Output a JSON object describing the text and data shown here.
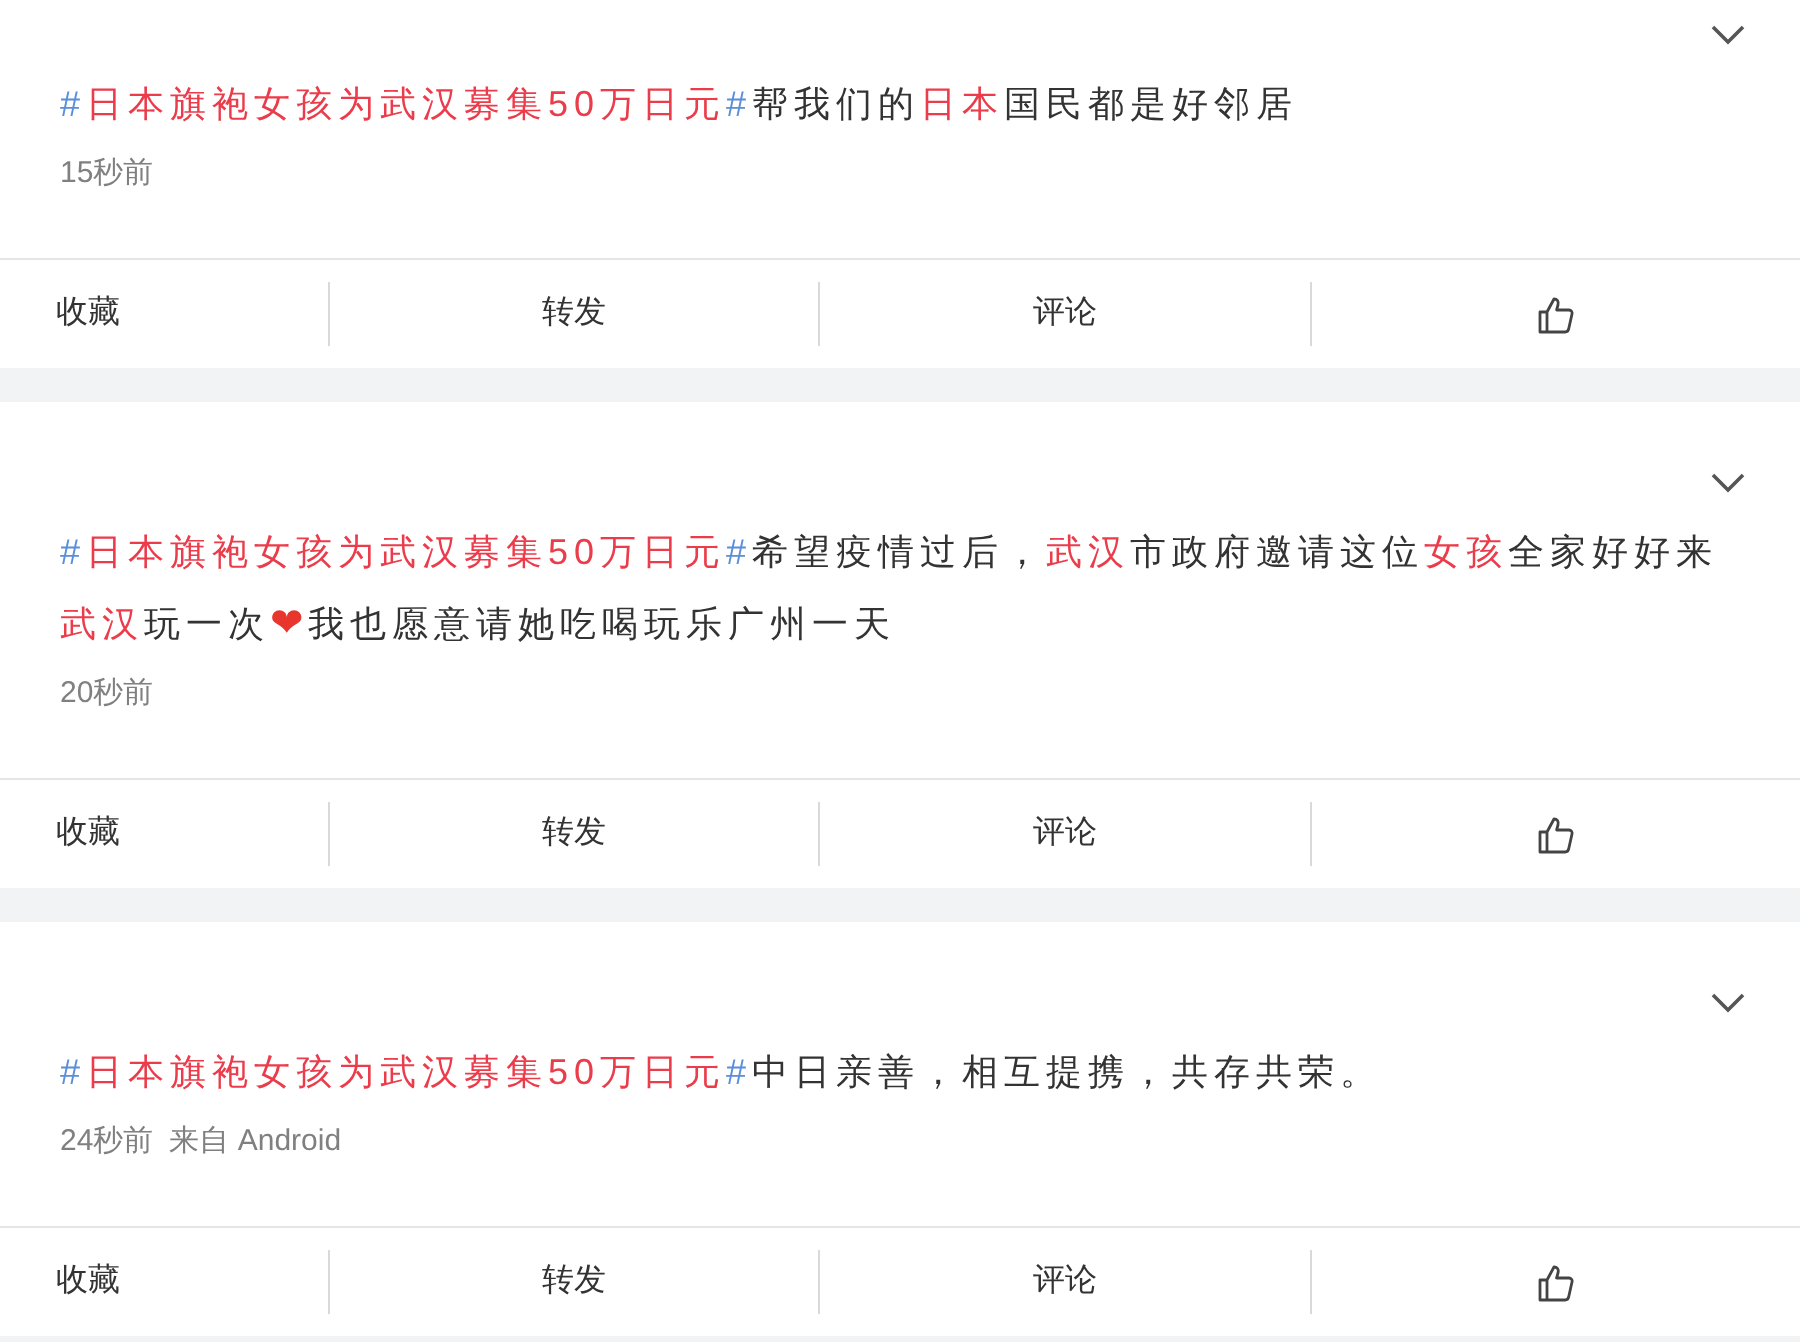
{
  "posts": [
    {
      "text": [
        {
          "kind": "hash",
          "text": "#"
        },
        {
          "kind": "topic",
          "text": "日本旗袍女孩为武汉募集50万日元"
        },
        {
          "kind": "hash",
          "text": "#"
        },
        {
          "kind": "plain",
          "text": "帮我们的"
        },
        {
          "kind": "topic",
          "text": "日本"
        },
        {
          "kind": "plain",
          "text": "国民都是好邻居"
        }
      ],
      "meta": [
        "15秒前"
      ],
      "actions": [
        {
          "kind": "favorite",
          "label": "收藏"
        },
        {
          "kind": "repost",
          "label": "转发"
        },
        {
          "kind": "comment",
          "label": "评论"
        },
        {
          "kind": "like"
        }
      ]
    },
    {
      "text": [
        {
          "kind": "hash",
          "text": "#"
        },
        {
          "kind": "topic",
          "text": "日本旗袍女孩为武汉募集50万日元"
        },
        {
          "kind": "hash",
          "text": "#"
        },
        {
          "kind": "plain",
          "text": "希望疫情过后，"
        },
        {
          "kind": "topic",
          "text": "武汉"
        },
        {
          "kind": "plain",
          "text": "市政府邀请这位"
        },
        {
          "kind": "topic",
          "text": "女孩"
        },
        {
          "kind": "plain",
          "text": "全家好好来"
        },
        {
          "kind": "topic",
          "text": "武汉"
        },
        {
          "kind": "plain",
          "text": "玩一次"
        },
        {
          "kind": "heart",
          "text": "❤"
        },
        {
          "kind": "plain",
          "text": "我也愿意请她吃喝玩乐广州一天"
        }
      ],
      "meta": [
        "20秒前"
      ],
      "actions": [
        {
          "kind": "favorite",
          "label": "收藏"
        },
        {
          "kind": "repost",
          "label": "转发"
        },
        {
          "kind": "comment",
          "label": "评论"
        },
        {
          "kind": "like"
        }
      ]
    },
    {
      "text": [
        {
          "kind": "hash",
          "text": "#"
        },
        {
          "kind": "topic",
          "text": "日本旗袍女孩为武汉募集50万日元"
        },
        {
          "kind": "hash",
          "text": "#"
        },
        {
          "kind": "plain",
          "text": "中日亲善，相互提携，共存共荣。"
        }
      ],
      "meta": [
        "24秒前",
        "来自 Android"
      ],
      "actions": [
        {
          "kind": "favorite",
          "label": "收藏"
        },
        {
          "kind": "repost",
          "label": "转发"
        },
        {
          "kind": "comment",
          "label": "评论"
        },
        {
          "kind": "like"
        }
      ]
    }
  ]
}
